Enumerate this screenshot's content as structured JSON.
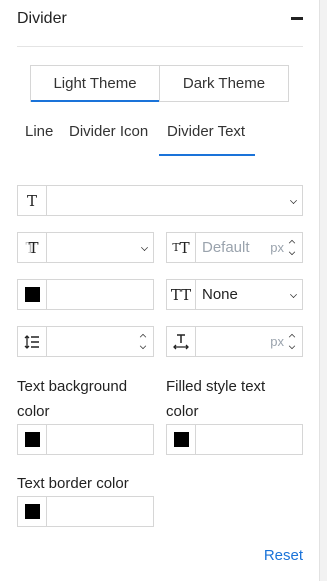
{
  "panel": {
    "title": "Divider",
    "collapse_icon": "minus-icon"
  },
  "theme_toggle": {
    "items": [
      "Light Theme",
      "Dark Theme"
    ],
    "active": "Light Theme",
    "accent": "#1a73d9"
  },
  "tabs": {
    "items": [
      "Line",
      "Divider Icon",
      "Divider Text"
    ],
    "active": "Divider Text"
  },
  "fields": {
    "font_family": {
      "icon": "text-font-icon",
      "value": ""
    },
    "font_weight": {
      "icon": "font-weight-icon",
      "value": ""
    },
    "font_size": {
      "icon": "font-size-icon",
      "placeholder": "Default",
      "unit": "px"
    },
    "text_color": {
      "swatch_color": "#000000",
      "value": ""
    },
    "text_transform": {
      "icon": "text-transform-icon",
      "value": "None"
    },
    "line_height": {
      "icon": "line-height-icon",
      "value": ""
    },
    "letter_spacing": {
      "icon": "letter-spacing-icon",
      "unit": "px"
    }
  },
  "color_fields": {
    "text_background": {
      "label": "Text background color",
      "swatch_color": "#000000"
    },
    "filled_style_text": {
      "label": "Filled style text color",
      "swatch_color": "#000000"
    },
    "text_border": {
      "label": "Text border color",
      "swatch_color": "#000000"
    }
  },
  "reset_label": "Reset"
}
